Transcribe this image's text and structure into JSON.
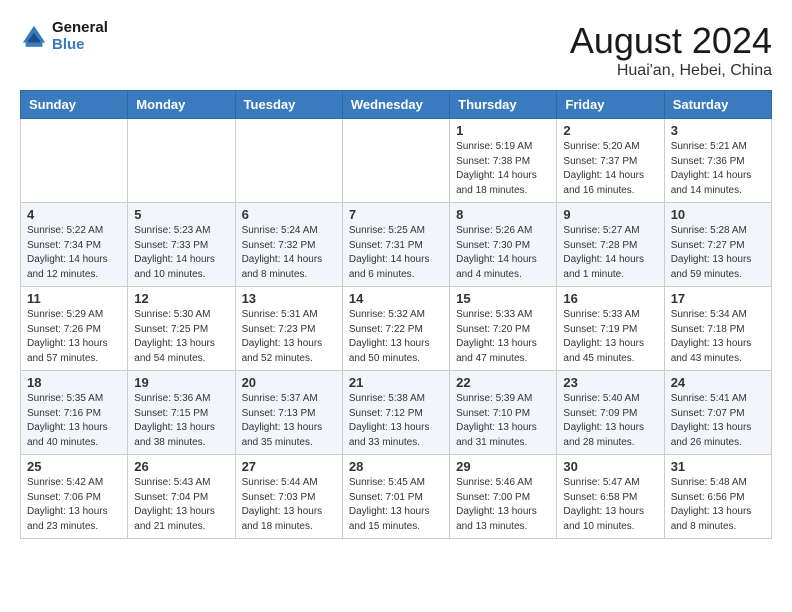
{
  "header": {
    "logo_line1": "General",
    "logo_line2": "Blue",
    "month": "August 2024",
    "location": "Huai'an, Hebei, China"
  },
  "days_of_week": [
    "Sunday",
    "Monday",
    "Tuesday",
    "Wednesday",
    "Thursday",
    "Friday",
    "Saturday"
  ],
  "weeks": [
    [
      {
        "day": "",
        "info": ""
      },
      {
        "day": "",
        "info": ""
      },
      {
        "day": "",
        "info": ""
      },
      {
        "day": "",
        "info": ""
      },
      {
        "day": "1",
        "info": "Sunrise: 5:19 AM\nSunset: 7:38 PM\nDaylight: 14 hours\nand 18 minutes."
      },
      {
        "day": "2",
        "info": "Sunrise: 5:20 AM\nSunset: 7:37 PM\nDaylight: 14 hours\nand 16 minutes."
      },
      {
        "day": "3",
        "info": "Sunrise: 5:21 AM\nSunset: 7:36 PM\nDaylight: 14 hours\nand 14 minutes."
      }
    ],
    [
      {
        "day": "4",
        "info": "Sunrise: 5:22 AM\nSunset: 7:34 PM\nDaylight: 14 hours\nand 12 minutes."
      },
      {
        "day": "5",
        "info": "Sunrise: 5:23 AM\nSunset: 7:33 PM\nDaylight: 14 hours\nand 10 minutes."
      },
      {
        "day": "6",
        "info": "Sunrise: 5:24 AM\nSunset: 7:32 PM\nDaylight: 14 hours\nand 8 minutes."
      },
      {
        "day": "7",
        "info": "Sunrise: 5:25 AM\nSunset: 7:31 PM\nDaylight: 14 hours\nand 6 minutes."
      },
      {
        "day": "8",
        "info": "Sunrise: 5:26 AM\nSunset: 7:30 PM\nDaylight: 14 hours\nand 4 minutes."
      },
      {
        "day": "9",
        "info": "Sunrise: 5:27 AM\nSunset: 7:28 PM\nDaylight: 14 hours\nand 1 minute."
      },
      {
        "day": "10",
        "info": "Sunrise: 5:28 AM\nSunset: 7:27 PM\nDaylight: 13 hours\nand 59 minutes."
      }
    ],
    [
      {
        "day": "11",
        "info": "Sunrise: 5:29 AM\nSunset: 7:26 PM\nDaylight: 13 hours\nand 57 minutes."
      },
      {
        "day": "12",
        "info": "Sunrise: 5:30 AM\nSunset: 7:25 PM\nDaylight: 13 hours\nand 54 minutes."
      },
      {
        "day": "13",
        "info": "Sunrise: 5:31 AM\nSunset: 7:23 PM\nDaylight: 13 hours\nand 52 minutes."
      },
      {
        "day": "14",
        "info": "Sunrise: 5:32 AM\nSunset: 7:22 PM\nDaylight: 13 hours\nand 50 minutes."
      },
      {
        "day": "15",
        "info": "Sunrise: 5:33 AM\nSunset: 7:20 PM\nDaylight: 13 hours\nand 47 minutes."
      },
      {
        "day": "16",
        "info": "Sunrise: 5:33 AM\nSunset: 7:19 PM\nDaylight: 13 hours\nand 45 minutes."
      },
      {
        "day": "17",
        "info": "Sunrise: 5:34 AM\nSunset: 7:18 PM\nDaylight: 13 hours\nand 43 minutes."
      }
    ],
    [
      {
        "day": "18",
        "info": "Sunrise: 5:35 AM\nSunset: 7:16 PM\nDaylight: 13 hours\nand 40 minutes."
      },
      {
        "day": "19",
        "info": "Sunrise: 5:36 AM\nSunset: 7:15 PM\nDaylight: 13 hours\nand 38 minutes."
      },
      {
        "day": "20",
        "info": "Sunrise: 5:37 AM\nSunset: 7:13 PM\nDaylight: 13 hours\nand 35 minutes."
      },
      {
        "day": "21",
        "info": "Sunrise: 5:38 AM\nSunset: 7:12 PM\nDaylight: 13 hours\nand 33 minutes."
      },
      {
        "day": "22",
        "info": "Sunrise: 5:39 AM\nSunset: 7:10 PM\nDaylight: 13 hours\nand 31 minutes."
      },
      {
        "day": "23",
        "info": "Sunrise: 5:40 AM\nSunset: 7:09 PM\nDaylight: 13 hours\nand 28 minutes."
      },
      {
        "day": "24",
        "info": "Sunrise: 5:41 AM\nSunset: 7:07 PM\nDaylight: 13 hours\nand 26 minutes."
      }
    ],
    [
      {
        "day": "25",
        "info": "Sunrise: 5:42 AM\nSunset: 7:06 PM\nDaylight: 13 hours\nand 23 minutes."
      },
      {
        "day": "26",
        "info": "Sunrise: 5:43 AM\nSunset: 7:04 PM\nDaylight: 13 hours\nand 21 minutes."
      },
      {
        "day": "27",
        "info": "Sunrise: 5:44 AM\nSunset: 7:03 PM\nDaylight: 13 hours\nand 18 minutes."
      },
      {
        "day": "28",
        "info": "Sunrise: 5:45 AM\nSunset: 7:01 PM\nDaylight: 13 hours\nand 15 minutes."
      },
      {
        "day": "29",
        "info": "Sunrise: 5:46 AM\nSunset: 7:00 PM\nDaylight: 13 hours\nand 13 minutes."
      },
      {
        "day": "30",
        "info": "Sunrise: 5:47 AM\nSunset: 6:58 PM\nDaylight: 13 hours\nand 10 minutes."
      },
      {
        "day": "31",
        "info": "Sunrise: 5:48 AM\nSunset: 6:56 PM\nDaylight: 13 hours\nand 8 minutes."
      }
    ]
  ]
}
